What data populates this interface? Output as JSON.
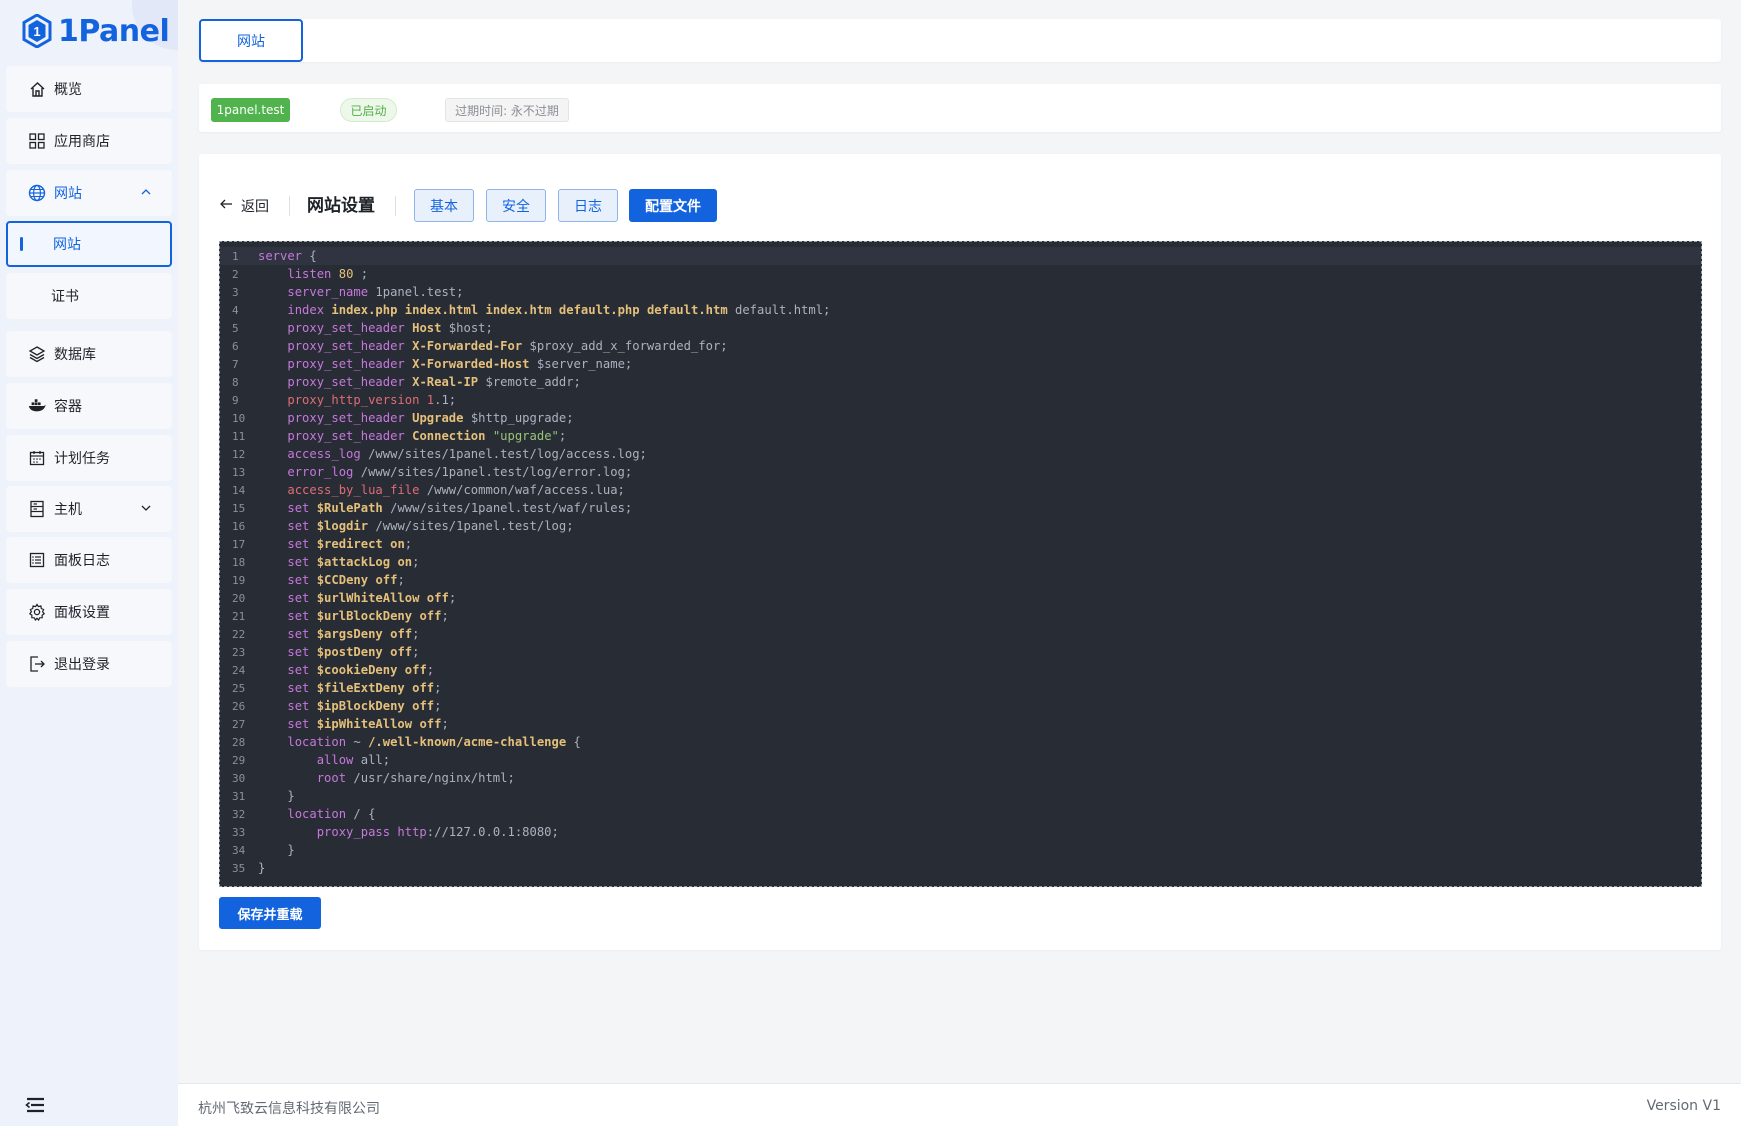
{
  "sidebar": {
    "logo_text": "1Panel",
    "items": {
      "overview": "概览",
      "appstore": "应用商店",
      "website": "网站",
      "website_sub_website": "网站",
      "website_sub_cert": "证书",
      "database": "数据库",
      "container": "容器",
      "cronjob": "计划任务",
      "host": "主机",
      "panel_log": "面板日志",
      "panel_settings": "面板设置",
      "logout": "退出登录"
    }
  },
  "tabbar": {
    "active_tab": "网站"
  },
  "info": {
    "domain": "1panel.test",
    "status": "已启动",
    "expire": "过期时间: 永不过期"
  },
  "toolbar": {
    "back": "返回",
    "title": "网站设置",
    "tabs": {
      "basic": "基本",
      "security": "安全",
      "log": "日志",
      "config": "配置文件"
    },
    "active_tab": "配置文件"
  },
  "editor": {
    "language": "nginx",
    "lines": [
      "server {",
      "    listen 80 ;",
      "    server_name 1panel.test;",
      "    index index.php index.html index.htm default.php default.htm default.html;",
      "    proxy_set_header Host $host;",
      "    proxy_set_header X-Forwarded-For $proxy_add_x_forwarded_for;",
      "    proxy_set_header X-Forwarded-Host $server_name;",
      "    proxy_set_header X-Real-IP $remote_addr;",
      "    proxy_http_version 1.1;",
      "    proxy_set_header Upgrade $http_upgrade;",
      "    proxy_set_header Connection \"upgrade\";",
      "    access_log /www/sites/1panel.test/log/access.log;",
      "    error_log /www/sites/1panel.test/log/error.log;",
      "    access_by_lua_file /www/common/waf/access.lua;",
      "    set $RulePath /www/sites/1panel.test/waf/rules;",
      "    set $logdir /www/sites/1panel.test/log;",
      "    set $redirect on;",
      "    set $attackLog on;",
      "    set $CCDeny off;",
      "    set $urlWhiteAllow off;",
      "    set $urlBlockDeny off;",
      "    set $argsDeny off;",
      "    set $postDeny off;",
      "    set $cookieDeny off;",
      "    set $fileExtDeny off;",
      "    set $ipBlockDeny off;",
      "    set $ipWhiteAllow off;",
      "    location ~ /.well-known/acme-challenge {",
      "        allow all;",
      "        root /usr/share/nginx/html;",
      "    }",
      "    location / {",
      "        proxy_pass http://127.0.0.1:8080;",
      "    }",
      "}"
    ]
  },
  "save_button": "保存并重载",
  "footer": {
    "company": "杭州飞致云信息科技有限公司",
    "version": "Version V1"
  },
  "colors": {
    "accent": "#1363df",
    "success": "#51b34d",
    "editor_bg": "#282c34"
  }
}
